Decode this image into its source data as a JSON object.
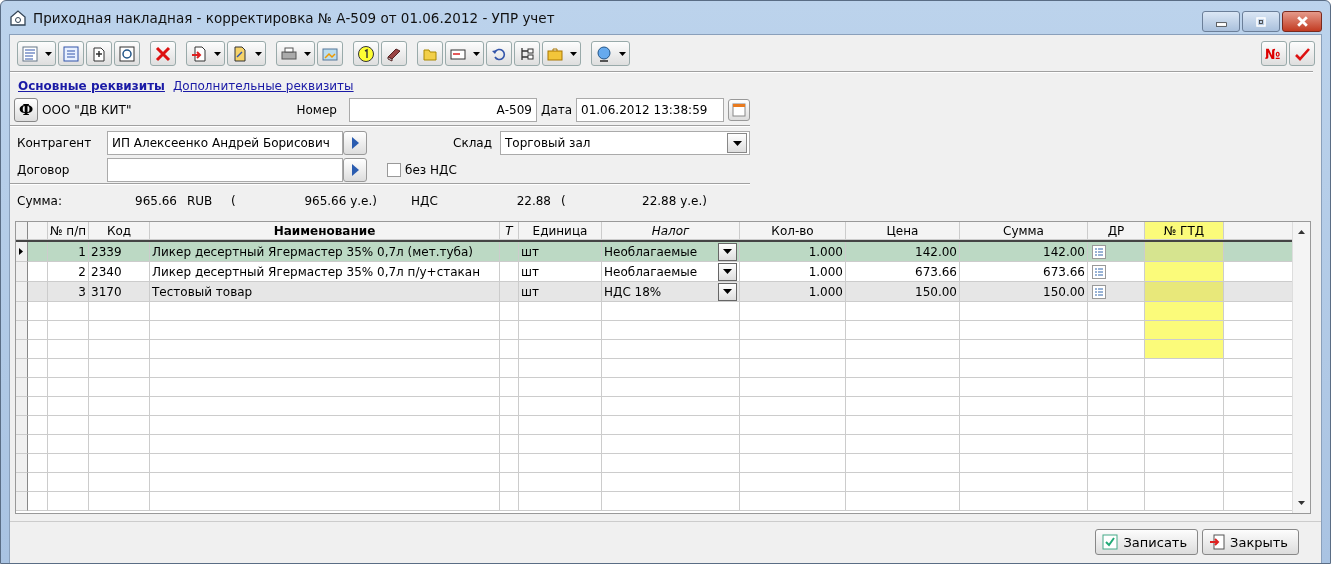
{
  "window": {
    "title": "Приходная накладная - корректировка № А-509 от 01.06.2012 - УПР учет"
  },
  "toolbar_right": {
    "number_button": "№"
  },
  "tabs": [
    {
      "label": "Основные реквизиты",
      "selected": true
    },
    {
      "label": "Дополнительные реквизиты",
      "selected": false
    }
  ],
  "header": {
    "firm_button": "Ф",
    "firm": "ООО \"ДВ КИТ\"",
    "number_label": "Номер",
    "number": "А-509",
    "date_label": "Дата",
    "date": "01.06.2012 13:38:59"
  },
  "form": {
    "counterparty_label": "Контрагент",
    "counterparty": "ИП Алексеенко Андрей Борисович",
    "warehouse_label": "Склад",
    "warehouse": "Торговый зал",
    "contract_label": "Договор",
    "no_vat": {
      "label": "без НДС",
      "checked": false
    }
  },
  "totals": {
    "sum_label": "Сумма:",
    "sum": "965.66",
    "currency": "RUB",
    "sum_paren": "(",
    "sum_ue": "965.66 у.е.)",
    "vat_label": "НДС",
    "vat": "22.88",
    "vat_paren": "(",
    "vat_ue": "22.88 у.е.)"
  },
  "table": {
    "columns": [
      {
        "label": "№ п/п",
        "bold": false,
        "italic": false,
        "highlighted": false
      },
      {
        "label": "Код",
        "bold": false,
        "italic": false,
        "highlighted": false
      },
      {
        "label": "Наименование",
        "bold": true,
        "italic": false,
        "highlighted": false
      },
      {
        "label": "Т",
        "bold": false,
        "italic": true,
        "highlighted": false
      },
      {
        "label": "Единица",
        "bold": false,
        "italic": false,
        "highlighted": false
      },
      {
        "label": "Налог",
        "bold": false,
        "italic": true,
        "highlighted": false
      },
      {
        "label": "Кол-во",
        "bold": false,
        "italic": false,
        "highlighted": false
      },
      {
        "label": "Цена",
        "bold": false,
        "italic": false,
        "highlighted": false
      },
      {
        "label": "Сумма",
        "bold": false,
        "italic": false,
        "highlighted": false
      },
      {
        "label": "ДР",
        "bold": false,
        "italic": false,
        "highlighted": false
      },
      {
        "label": "№ ГТД",
        "bold": false,
        "italic": false,
        "highlighted": true
      }
    ],
    "rows": [
      {
        "num": "1",
        "code": "2339",
        "name": "Ликер десертный Ягермастер 35% 0,7л (мет.туба)",
        "unit": "шт",
        "tax": "Необлагаемые",
        "qty": "1.000",
        "price": "142.00",
        "sum": "142.00",
        "selected": true
      },
      {
        "num": "2",
        "code": "2340",
        "name": "Ликер десертный Ягермастер 35% 0,7л п/у+стакан",
        "unit": "шт",
        "tax": "Необлагаемые",
        "qty": "1.000",
        "price": "673.66",
        "sum": "673.66",
        "selected": false
      },
      {
        "num": "3",
        "code": "3170",
        "name": "Тестовый товар",
        "unit": "шт",
        "tax": "НДС 18%",
        "qty": "1.000",
        "price": "150.00",
        "sum": "150.00",
        "selected": false
      }
    ]
  },
  "buttons": [
    {
      "label": "Записать",
      "kind": "save"
    },
    {
      "label": "Закрыть",
      "kind": "close"
    }
  ]
}
